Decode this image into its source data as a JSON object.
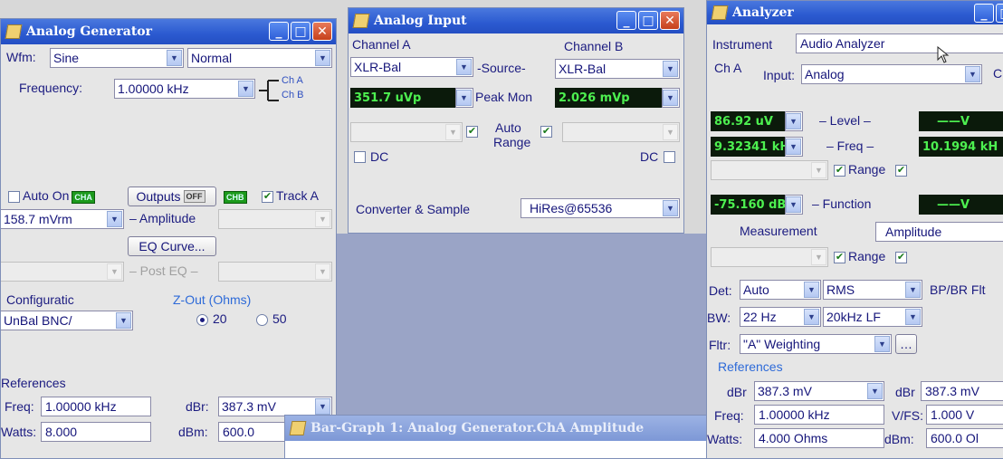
{
  "analog_generator": {
    "title": "Analog Generator",
    "wfm_label": "Wfm:",
    "wfm_value": "Sine",
    "wfm_mode": "Normal",
    "frequency_label": "Frequency:",
    "frequency_value": "1.00000 kHz",
    "ch_a": "Ch A",
    "ch_b": "Ch B",
    "auto_on_label": "Auto On",
    "cha_badge": "CHA",
    "outputs_label": "Outputs",
    "outputs_badge": "OFF",
    "chb_badge": "CHB",
    "track_a_label": "Track A",
    "amplitude_value": "158.7  mVrm",
    "amplitude_label": "– Amplitude",
    "eq_curve_label": "EQ Curve...",
    "post_eq_label": "– Post EQ –",
    "configuration_label": "Configuratic",
    "configuration_value": "UnBal BNC/",
    "zout_label": "Z-Out (Ohms)",
    "zout_20": "20",
    "zout_50": "50",
    "references_label": "References",
    "freq_label": "Freq:",
    "freq_value": "1.00000 kHz",
    "dbr_label": "dBr:",
    "dbr_value": "387.3   mV",
    "watts_label": "Watts:",
    "watts_value": "8.000",
    "dbm_label": "dBm:",
    "dbm_value": "600.0"
  },
  "analog_input": {
    "title": "Analog Input",
    "channel_a_label": "Channel A",
    "channel_b_label": "Channel B",
    "source_label": "-Source-",
    "source_a": "XLR-Bal",
    "source_b": "XLR-Bal",
    "peak_a": "351.7  uVp",
    "peak_label": "Peak Mon",
    "peak_b": "2.026  mVp",
    "auto_label": "Auto",
    "range_label": "Range",
    "dc_a_label": "DC",
    "dc_b_label": "DC",
    "converter_label": "Converter & Sample",
    "converter_value": "HiRes@65536"
  },
  "bar_graph": {
    "title": "Bar-Graph 1: Analog Generator.ChA Amplitude"
  },
  "analyzer": {
    "title": "Analyzer",
    "instrument_label": "Instrument",
    "instrument_value": "Audio Analyzer",
    "ch_a_label": "Ch A",
    "input_label": "Input:",
    "input_value": "Analog",
    "ch_b_cut": "C",
    "level_a": "86.92  uV",
    "level_label": "– Level –",
    "level_b": "——V",
    "freq_a": "9.32341 kHz",
    "freq_label": "– Freq –",
    "freq_b": "10.1994 kH",
    "range_label": "Range",
    "function_a": "-75.160  dBr",
    "function_label": "– Function",
    "function_b": "——V",
    "measurement_label": "Measurement",
    "measurement_value": "Amplitude",
    "det_label": "Det:",
    "det_value": "Auto",
    "rms_value": "RMS",
    "bpbr_label": "BP/BR Flt",
    "bw_label": "BW:",
    "bw_low": "22 Hz",
    "bw_high": "20kHz LF",
    "fltr_label": "Fltr:",
    "fltr_value": "\"A\" Weighting",
    "references_label": "References",
    "dbr_a_label": "dBr",
    "dbr_a_value": "387.3   mV",
    "dbr_b_label": "dBr",
    "dbr_b_value": "387.3   mV",
    "freq_ref_label": "Freq:",
    "freq_ref_value": "1.00000 kHz",
    "vfs_label": "V/FS:",
    "vfs_value": "1.000    V",
    "watts_label": "Watts:",
    "watts_value": "4.000     Ohms",
    "dbm_label": "dBm:",
    "dbm_value": "600.0   Ol"
  }
}
